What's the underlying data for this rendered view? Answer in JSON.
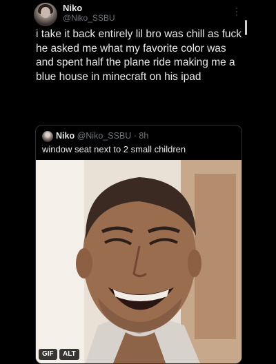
{
  "tweet": {
    "author_name": "Niko",
    "author_handle": "@Niko_SSBU",
    "text": "i take it back entirely lil bro was chill as fuck he asked me what my favorite color was and spent half the plane ride making me a blue house in minecraft on his ipad",
    "more_icon": "more-dots-icon"
  },
  "quote": {
    "author_name": "Niko",
    "author_handle": "@Niko_SSBU",
    "separator": "·",
    "time": "8h",
    "text": "window seat next to 2 small children",
    "media": {
      "gif_label": "GIF",
      "alt_label": "ALT"
    }
  }
}
